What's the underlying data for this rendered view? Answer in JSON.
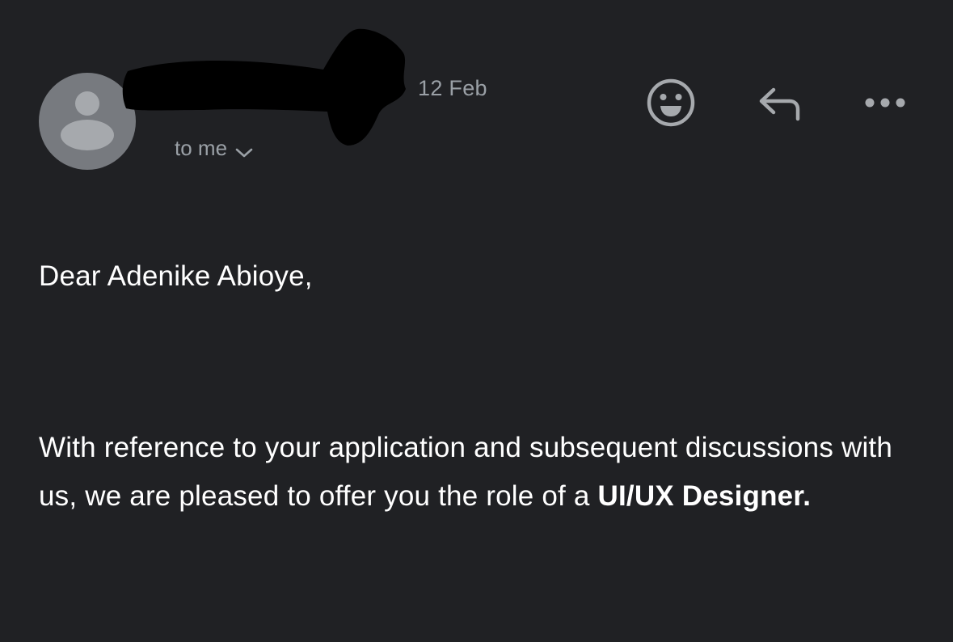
{
  "header": {
    "date": "12 Feb",
    "recipient_label": "to me",
    "icons": {
      "avatar": "person-icon",
      "expand": "chevron-down-icon",
      "emoji": "smiley-icon",
      "reply": "reply-arrow-icon",
      "more": "more-horizontal-icon"
    }
  },
  "message": {
    "greeting": "Dear Adenike Abioye,",
    "paragraph": "With reference to your application and subsequent discussions with us, we are pleased to offer you the role of a",
    "role": "UI/UX Designer."
  },
  "colors": {
    "background": "#202124",
    "secondary_text": "#9aa0a6",
    "avatar": "#777a7f",
    "redaction": "#000000"
  }
}
